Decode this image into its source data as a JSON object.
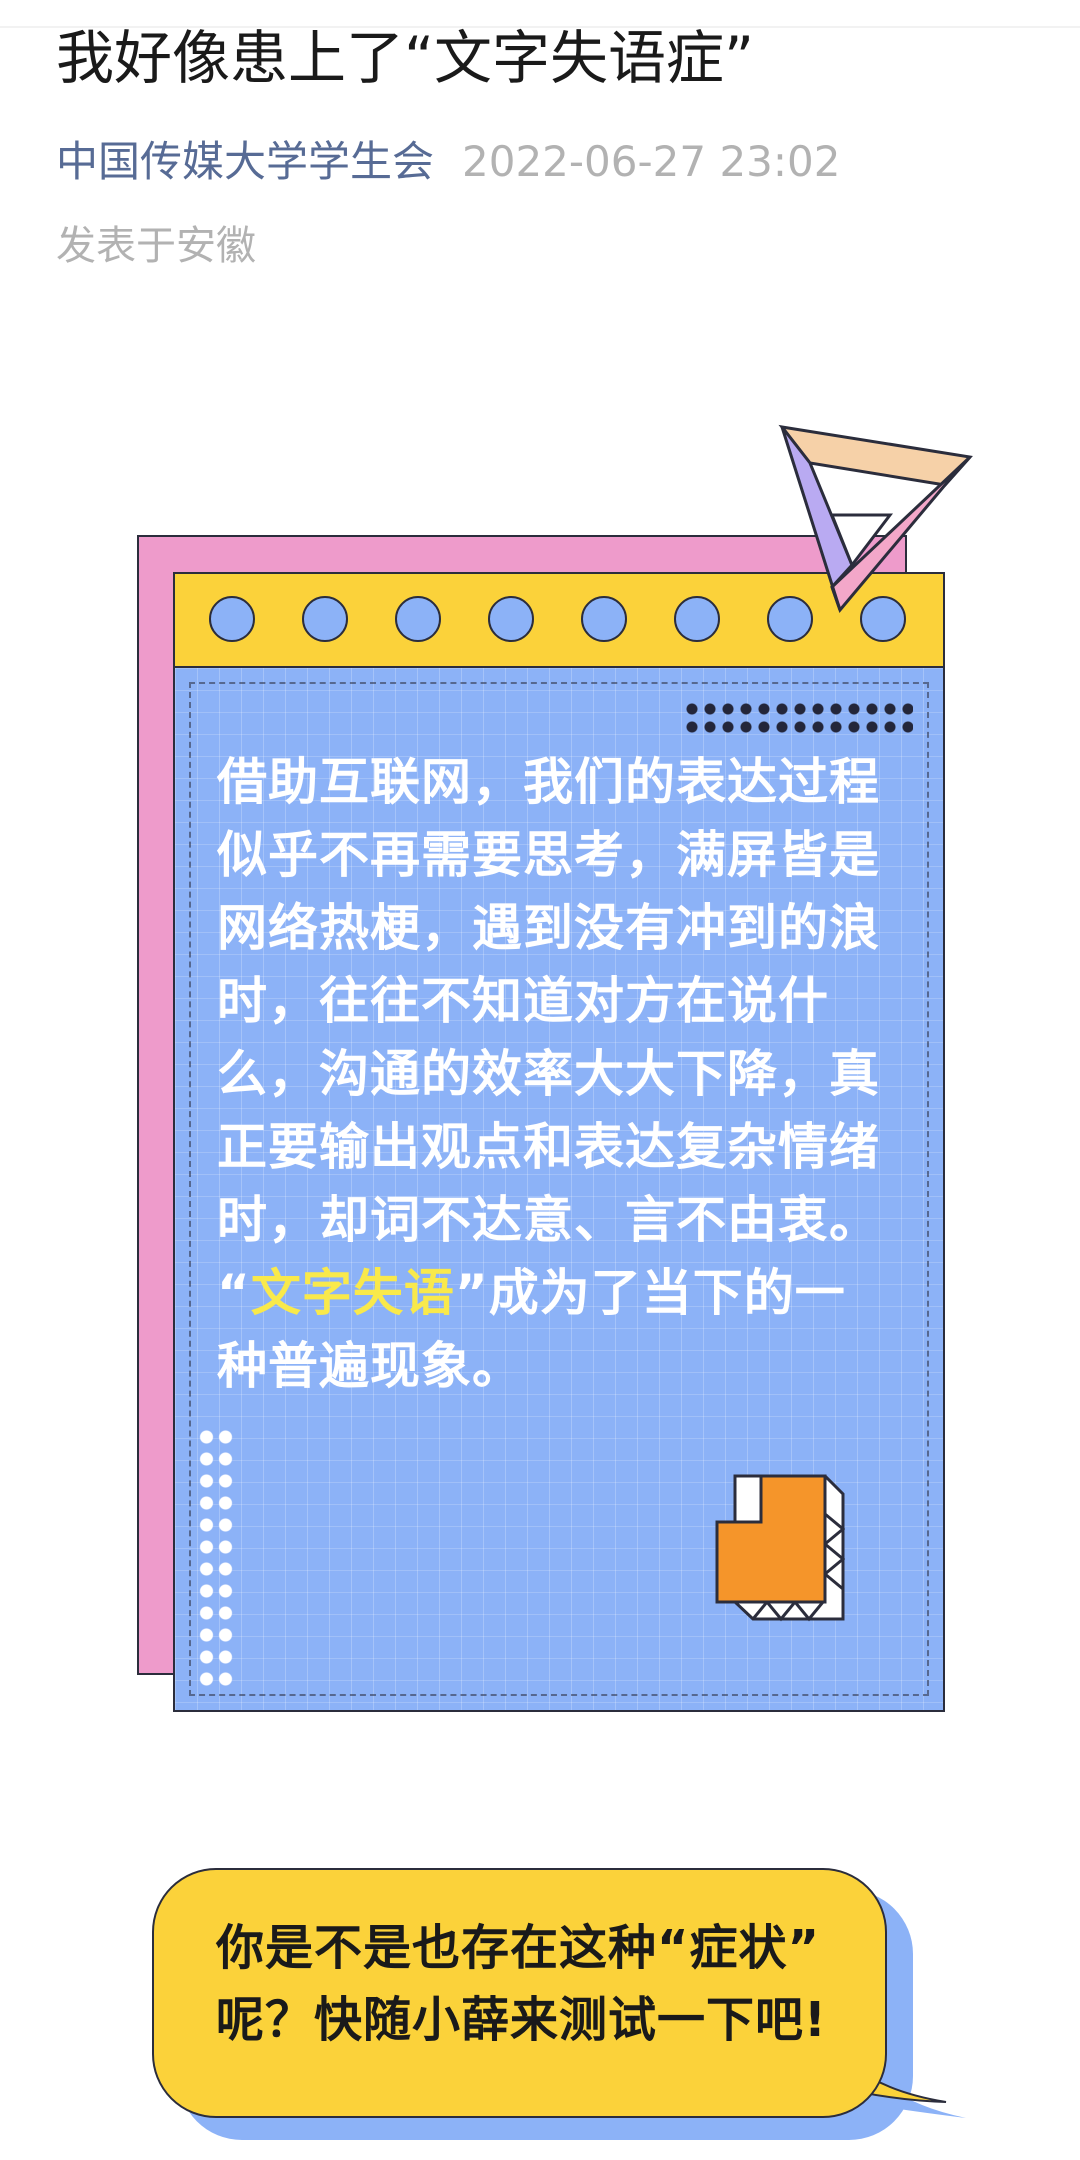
{
  "article": {
    "title": "我好像患上了“文字失语症”",
    "author": "中国传媒大学学生会",
    "date": "2022-06-27 23:02",
    "location": "发表于安徽"
  },
  "card": {
    "lines": [
      "借助互联网，我们的表达过程",
      "似乎不再需要思考，满屏皆是",
      "网络热梗，遇到没有冲到的浪",
      "时，往往不知道对方在说什",
      "么，沟通的效率大大下降，真",
      "正要输出观点和表达复杂情绪",
      "时，却词不达意、言不由衷。"
    ],
    "quote_open": "“",
    "highlight": "文字失语",
    "quote_rest": "”成为了当下的一",
    "last_line": "种普遍现象。",
    "colors": {
      "panel": "#8cb2f7",
      "header": "#fbd23a",
      "shadow": "#ee9bcb",
      "highlight": "#f9e94b",
      "block": "#f5952a"
    }
  },
  "bubble": {
    "line1": "你是不是也存在这种“症状”",
    "line2": "呢？快随小薛来测试一下吧!"
  }
}
